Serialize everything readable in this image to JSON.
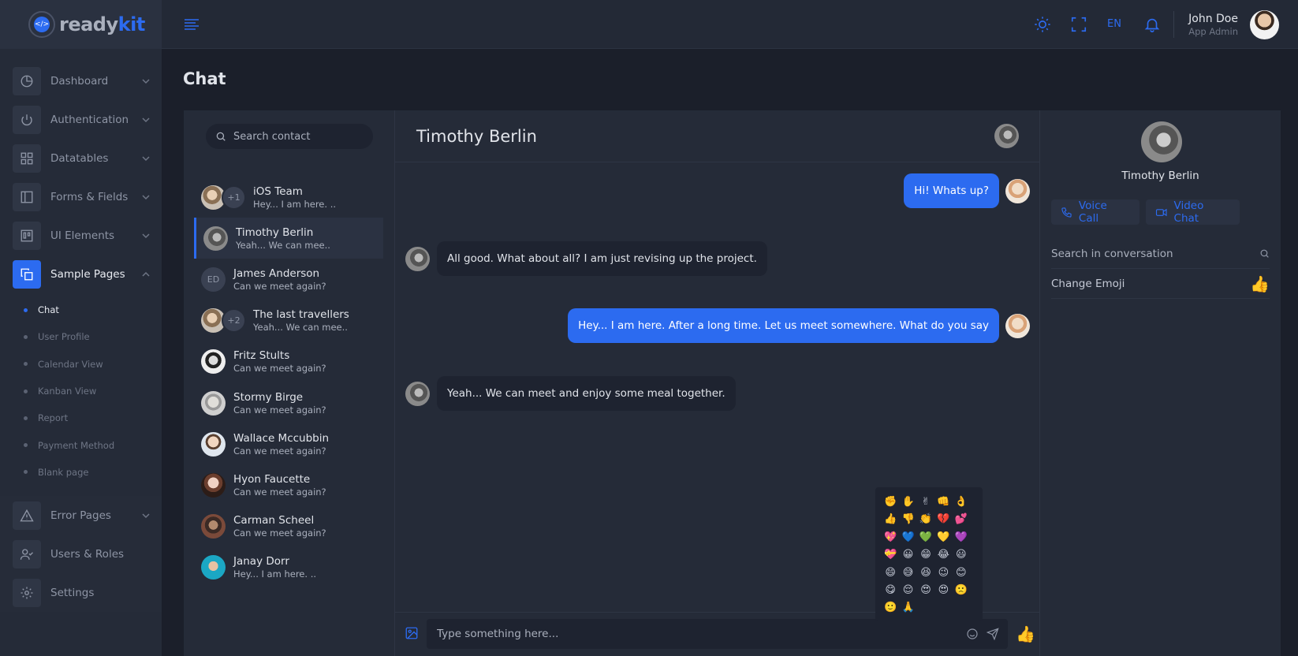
{
  "brand": {
    "name_a": "ready",
    "name_b": "kit"
  },
  "topbar": {
    "lang": "EN",
    "user_name": "John Doe",
    "user_role": "App Admin"
  },
  "sidebar": {
    "items": [
      {
        "label": "Dashboard"
      },
      {
        "label": "Authentication"
      },
      {
        "label": "Datatables"
      },
      {
        "label": "Forms & Fields"
      },
      {
        "label": "UI Elements"
      },
      {
        "label": "Sample Pages"
      }
    ],
    "sub_items": [
      {
        "label": "Chat"
      },
      {
        "label": "User Profile"
      },
      {
        "label": "Calendar View"
      },
      {
        "label": "Kanban View"
      },
      {
        "label": "Report"
      },
      {
        "label": "Payment Method"
      },
      {
        "label": "Blank page"
      }
    ],
    "lower_items": [
      {
        "label": "Error Pages"
      },
      {
        "label": "Users & Roles"
      },
      {
        "label": "Settings"
      }
    ]
  },
  "page": {
    "title": "Chat"
  },
  "contacts": {
    "search_placeholder": "Search contact",
    "list": [
      {
        "name": "iOS Team",
        "message": "Hey... I am here. ..",
        "extra": "+1"
      },
      {
        "name": "Timothy Berlin",
        "message": "Yeah... We can mee.."
      },
      {
        "name": "James Anderson",
        "message": "Can we meet again?",
        "initials": "ED"
      },
      {
        "name": "The last travellers",
        "message": "Yeah... We can mee..",
        "extra": "+2"
      },
      {
        "name": "Fritz Stults",
        "message": "Can we meet again?"
      },
      {
        "name": "Stormy Birge",
        "message": "Can we meet again?"
      },
      {
        "name": "Wallace Mccubbin",
        "message": "Can we meet again?"
      },
      {
        "name": "Hyon Faucette",
        "message": "Can we meet again?"
      },
      {
        "name": "Carman Scheel",
        "message": "Can we meet again?"
      },
      {
        "name": "Janay Dorr",
        "message": "Hey... I am here. .."
      }
    ]
  },
  "conversation": {
    "title": "Timothy Berlin",
    "messages": [
      {
        "text": "Hi! Whats up?",
        "direction": "out"
      },
      {
        "text": "All good. What about all? I am just revising up the project.",
        "direction": "in"
      },
      {
        "text": "Hey... I am here. After a long time. Let us meet somewhere. What do you say",
        "direction": "out"
      },
      {
        "text": "Yeah... We can meet and enjoy some meal together.",
        "direction": "in"
      }
    ],
    "input_placeholder": "Type something here...",
    "emojis": [
      "✊",
      "✋",
      "✌",
      "👊",
      "👌",
      "👍",
      "👎",
      "👏",
      "💔",
      "💕",
      "💖",
      "💙",
      "💚",
      "💛",
      "💜",
      "💝",
      "😀",
      "😁",
      "😂",
      "😃",
      "😄",
      "😅",
      "😆",
      "😉",
      "😊",
      "😋",
      "😌",
      "😍",
      "😍",
      "🙁",
      "🙂",
      "🙏"
    ],
    "send_emoji": "👍"
  },
  "profile": {
    "name": "Timothy Berlin",
    "voice_call": "Voice Call",
    "video_chat": "Video Chat",
    "search_placeholder": "Search in conversation",
    "change_emoji": "Change Emoji",
    "emoji": "👍"
  },
  "colors": {
    "accent": "#2c6bf0",
    "background": "#1b1f2a",
    "panel": "#252b38"
  }
}
